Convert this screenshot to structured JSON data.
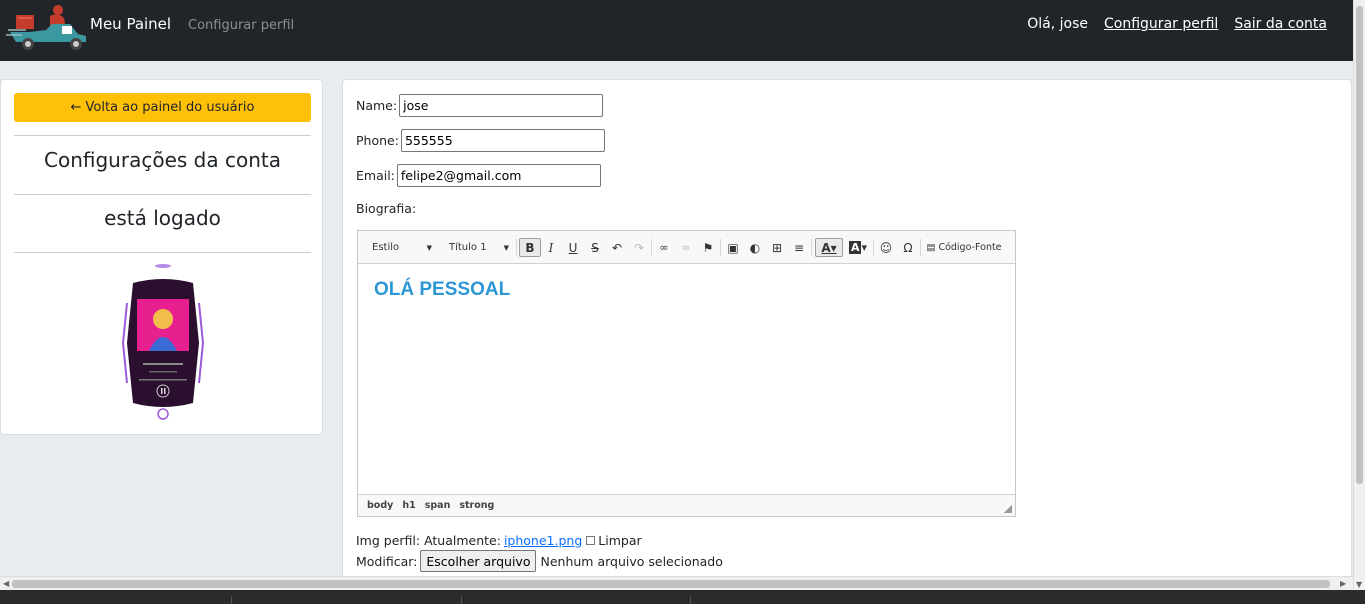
{
  "navbar": {
    "brand": "Meu Painel",
    "subtitle": "Configurar perfil",
    "greeting": "Olá,  jose",
    "config_link": "Configurar perfil",
    "logout_link": "Sair da conta"
  },
  "sidebar": {
    "back_button": "← Volta ao painel do usuário",
    "title": "Configurações da conta",
    "status": "está logado"
  },
  "form": {
    "name_label": "Name:",
    "name_value": "jose",
    "phone_label": "Phone:",
    "phone_value": "555555",
    "email_label": "Email:",
    "email_value": "felipe2@gmail.com",
    "bio_label": "Biografia:",
    "img_label": "Img perfil: Atualmente:",
    "img_link": "iphone1.png",
    "clear_label": "Limpar",
    "modify_label": "Modificar:",
    "file_button": "Escolher arquivo",
    "no_file": "Nenhum arquivo selecionado"
  },
  "editor": {
    "style_combo": "Estilo",
    "format_combo": "Título 1",
    "source_label": "Código-Fonte",
    "content": "OLÁ PESSOAL",
    "path": [
      "body",
      "h1",
      "span",
      "strong"
    ]
  },
  "colors": {
    "navbar_bg": "#212529",
    "warning": "#ffc107",
    "heading_blue": "#2d97d6",
    "link_blue": "#0d6efd"
  }
}
